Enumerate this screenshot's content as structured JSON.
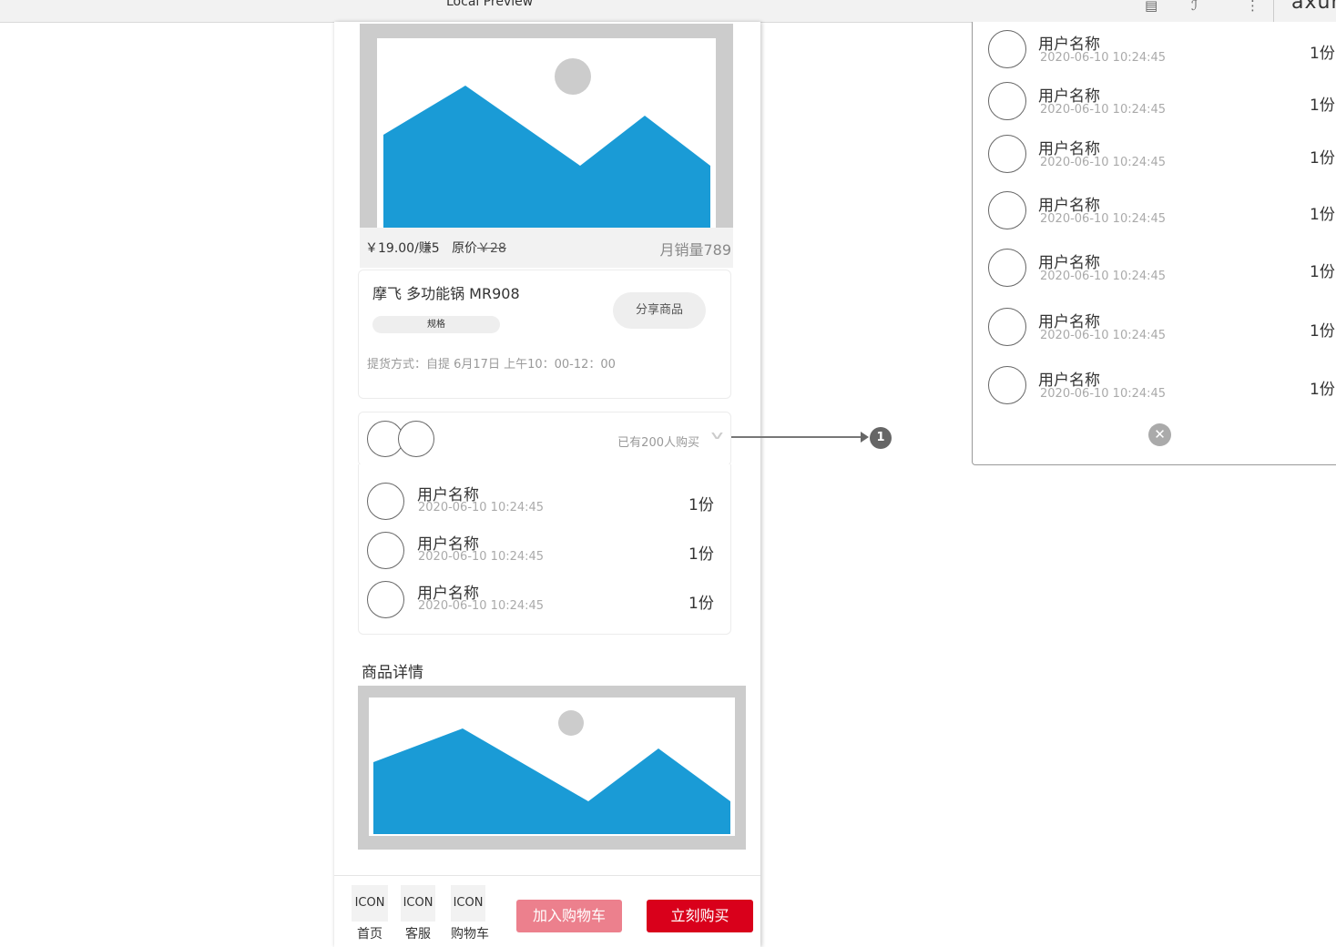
{
  "window": {
    "title": "Local Preview",
    "brand": "axur"
  },
  "product": {
    "price": "￥19.00/赚5",
    "original_label": "原价",
    "original_price": "￥28",
    "monthly_sales": "月销量789",
    "name": "摩飞 多功能锅 MR908",
    "spec_tag": "规格",
    "share_button": "分享商品",
    "pickup": "提货方式：自提 6月17日 上午10：00-12：00"
  },
  "buyers": {
    "summary": "已有200人购买",
    "expand_icon": "chevron-down-icon",
    "list": [
      {
        "name": "用户名称",
        "time": "2020-06-10 10:24:45",
        "qty": "1份"
      },
      {
        "name": "用户名称",
        "time": "2020-06-10 10:24:45",
        "qty": "1份"
      },
      {
        "name": "用户名称",
        "time": "2020-06-10 10:24:45",
        "qty": "1份"
      }
    ]
  },
  "details": {
    "title": "商品详情"
  },
  "bottom_bar": {
    "nav": [
      {
        "icon": "ICON",
        "label": "首页"
      },
      {
        "icon": "ICON",
        "label": "客服"
      },
      {
        "icon": "ICON",
        "label": "购物车"
      }
    ],
    "add_to_cart": "加入购物车",
    "buy_now": "立刻购买"
  },
  "annotation": {
    "marker": "1"
  },
  "popup": {
    "list": [
      {
        "name": "用户名称",
        "time": "2020-06-10 10:24:45",
        "qty": "1份"
      },
      {
        "name": "用户名称",
        "time": "2020-06-10 10:24:45",
        "qty": "1份"
      },
      {
        "name": "用户名称",
        "time": "2020-06-10 10:24:45",
        "qty": "1份"
      },
      {
        "name": "用户名称",
        "time": "2020-06-10 10:24:45",
        "qty": "1份"
      },
      {
        "name": "用户名称",
        "time": "2020-06-10 10:24:45",
        "qty": "1份"
      },
      {
        "name": "用户名称",
        "time": "2020-06-10 10:24:45",
        "qty": "1份"
      },
      {
        "name": "用户名称",
        "time": "2020-06-10 10:24:45",
        "qty": "1份"
      }
    ],
    "close_icon": "close-icon"
  },
  "colors": {
    "image_fill": "#1a9bd6",
    "placeholder_gray": "#cccccc",
    "cart_button": "#ec808d",
    "buy_button": "#d9001b"
  }
}
